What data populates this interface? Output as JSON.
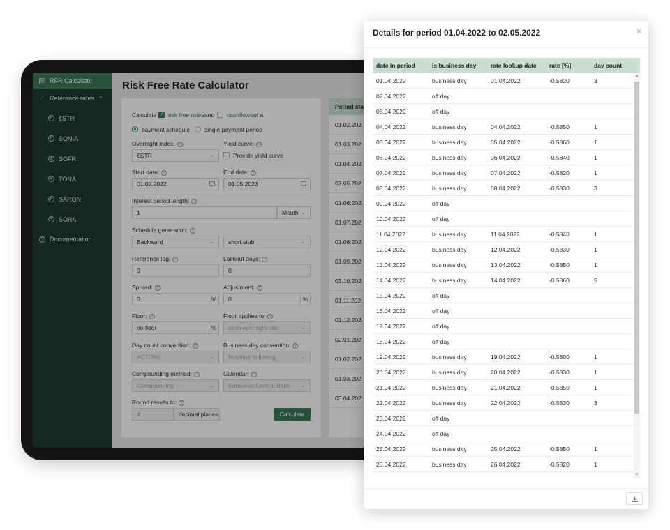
{
  "sidebar": {
    "items": [
      {
        "label": "RFR Calculator",
        "icon": "calculator-icon",
        "active": true
      },
      {
        "label": "Reference rates",
        "icon": "chart-line-icon",
        "expanded": true
      },
      {
        "label": "€STR",
        "icon": "euro-icon"
      },
      {
        "label": "SONIA",
        "icon": "pound-icon"
      },
      {
        "label": "SOFR",
        "icon": "dollar-icon"
      },
      {
        "label": "TONA",
        "icon": "yen-icon"
      },
      {
        "label": "SARON",
        "icon": "franc-icon"
      },
      {
        "label": "SORA",
        "icon": "singapore-dollar-icon"
      },
      {
        "label": "Documentation",
        "icon": "question-icon"
      }
    ]
  },
  "main": {
    "title": "Risk Free Rate Calculator"
  },
  "form": {
    "calculate_label": "Calculate",
    "risk_free_rates_label": "risk free rates",
    "and_label": "and",
    "cashflows_label": "cashflows",
    "of_a_label": "of a",
    "payment_schedule_label": "payment schedule",
    "single_payment_label": "single payment period",
    "overnight_index_label": "Overnight index:",
    "overnight_index_value": "€STR",
    "yield_curve_label": "Yield curve:",
    "provide_yield_curve_label": "Provide yield curve",
    "start_date_label": "Start date:",
    "start_date_value": "01.02.2022",
    "end_date_label": "End date:",
    "end_date_value": "01.05.2023",
    "interest_period_label": "Interest period length:",
    "interest_period_value": "1",
    "interest_period_unit": "Month",
    "schedule_gen_label": "Schedule generation:",
    "schedule_gen_value": "Backward",
    "stub_value": "short stub",
    "reference_lag_label": "Reference lag:",
    "reference_lag_value": "0",
    "lockout_days_label": "Lockout days:",
    "lockout_days_value": "0",
    "spread_label": "Spread:",
    "spread_value": "0",
    "adjustment_label": "Adjustment:",
    "adjustment_value": "0",
    "percent": "%",
    "floor_label": "Floor:",
    "floor_value": "no floor",
    "floor_applies_label": "Floor applies to:",
    "floor_applies_value": "each overnight rate",
    "day_count_label": "Day count convention:",
    "day_count_value": "ACT/360",
    "business_day_label": "Business day convention:",
    "business_day_value": "Modified following",
    "compounding_label": "Compounding method:",
    "compounding_value": "Compounding",
    "calendar_label": "Calendar:",
    "calendar_value": "European Central Bank",
    "round_label": "Round results to:",
    "round_value": "4",
    "decimal_places_label": "decimal places",
    "calculate_button": "Calculate"
  },
  "results": {
    "header": "Period sta",
    "rows": [
      "01.02.202",
      "01.03.202",
      "01.04.202",
      "02.05.202",
      "01.06.202",
      "01.07.202",
      "01.08.202",
      "01.09.202",
      "03.10.202",
      "01.11.202",
      "01.12.202",
      "02.01.202",
      "01.02.202",
      "01.03.202",
      "03.04.202"
    ]
  },
  "modal": {
    "title": "Details for period 01.04.2022 to 02.05.2022",
    "close_glyph": "×",
    "columns": [
      "date in period",
      "is business day",
      "rate lookup date",
      "rate [%]",
      "day count"
    ],
    "rows": [
      [
        "01.04.2022",
        "business day",
        "01.04.2022",
        "-0.5820",
        "3"
      ],
      [
        "02.04.2022",
        "off day",
        "",
        "",
        ""
      ],
      [
        "03.04.2022",
        "off day",
        "",
        "",
        ""
      ],
      [
        "04.04.2022",
        "business day",
        "04.04.2022",
        "-0.5850",
        "1"
      ],
      [
        "05.04.2022",
        "business day",
        "05.04.2022",
        "-0.5860",
        "1"
      ],
      [
        "06.04.2022",
        "business day",
        "06.04.2022",
        "-0.5840",
        "1"
      ],
      [
        "07.04.2022",
        "business day",
        "07.04.2022",
        "-0.5820",
        "1"
      ],
      [
        "08.04.2022",
        "business day",
        "08.04.2022",
        "-0.5830",
        "3"
      ],
      [
        "09.04.2022",
        "off day",
        "",
        "",
        ""
      ],
      [
        "10.04.2022",
        "off day",
        "",
        "",
        ""
      ],
      [
        "11.04.2022",
        "business day",
        "11.04.2022",
        "-0.5840",
        "1"
      ],
      [
        "12.04.2022",
        "business day",
        "12.04.2022",
        "-0.5830",
        "1"
      ],
      [
        "13.04.2022",
        "business day",
        "13.04.2022",
        "-0.5850",
        "1"
      ],
      [
        "14.04.2022",
        "business day",
        "14.04.2022",
        "-0.5860",
        "5"
      ],
      [
        "15.04.2022",
        "off day",
        "",
        "",
        ""
      ],
      [
        "16.04.2022",
        "off day",
        "",
        "",
        ""
      ],
      [
        "17.04.2022",
        "off day",
        "",
        "",
        ""
      ],
      [
        "18.04.2022",
        "off day",
        "",
        "",
        ""
      ],
      [
        "19.04.2022",
        "business day",
        "19.04.2022",
        "-0.5800",
        "1"
      ],
      [
        "20.04.2022",
        "business day",
        "20.04.2022",
        "-0.5830",
        "1"
      ],
      [
        "21.04.2022",
        "business day",
        "21.04.2022",
        "-0.5850",
        "1"
      ],
      [
        "22.04.2022",
        "business day",
        "22.04.2022",
        "-0.5830",
        "3"
      ],
      [
        "23.04.2022",
        "off day",
        "",
        "",
        ""
      ],
      [
        "24.04.2022",
        "off day",
        "",
        "",
        ""
      ],
      [
        "25.04.2022",
        "business day",
        "25.04.2022",
        "-0.5850",
        "1"
      ],
      [
        "26.04.2022",
        "business day",
        "26.04.2022",
        "-0.5820",
        "1"
      ]
    ]
  },
  "colors": {
    "sidebar_bg": "#1f3c2e",
    "accent": "#3b7a57",
    "table_header": "#c9ddd0"
  }
}
